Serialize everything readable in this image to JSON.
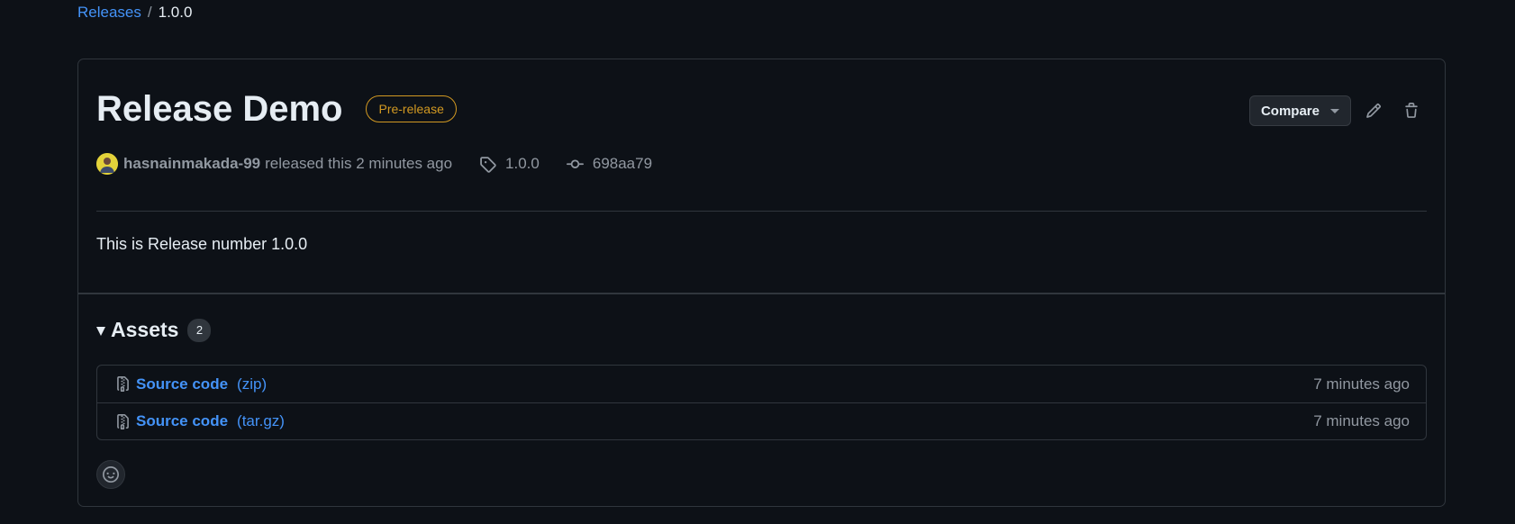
{
  "breadcrumb": {
    "parent": "Releases",
    "separator": "/",
    "current": "1.0.0"
  },
  "release": {
    "title": "Release Demo",
    "badge": "Pre-release",
    "author": "hasnainmakada-99",
    "released_text": "released this 2 minutes ago",
    "tag": "1.0.0",
    "commit": "698aa79",
    "body": "This is Release number 1.0.0"
  },
  "actions": {
    "compare_label": "Compare",
    "edit_icon": "pencil-icon",
    "delete_icon": "trash-icon"
  },
  "assets": {
    "title": "Assets",
    "count": "2",
    "items": [
      {
        "name": "Source code",
        "ext": "(zip)",
        "time": "7 minutes ago",
        "icon": "file-zip-icon"
      },
      {
        "name": "Source code",
        "ext": "(tar.gz)",
        "time": "7 minutes ago",
        "icon": "file-zip-icon"
      }
    ]
  },
  "reaction": {
    "icon": "smiley-icon"
  },
  "colors": {
    "background": "#0d1117",
    "border": "#30363d",
    "link": "#4493f8",
    "prerelease": "#d29922",
    "muted": "#9198a1",
    "text": "#e6edf3"
  }
}
